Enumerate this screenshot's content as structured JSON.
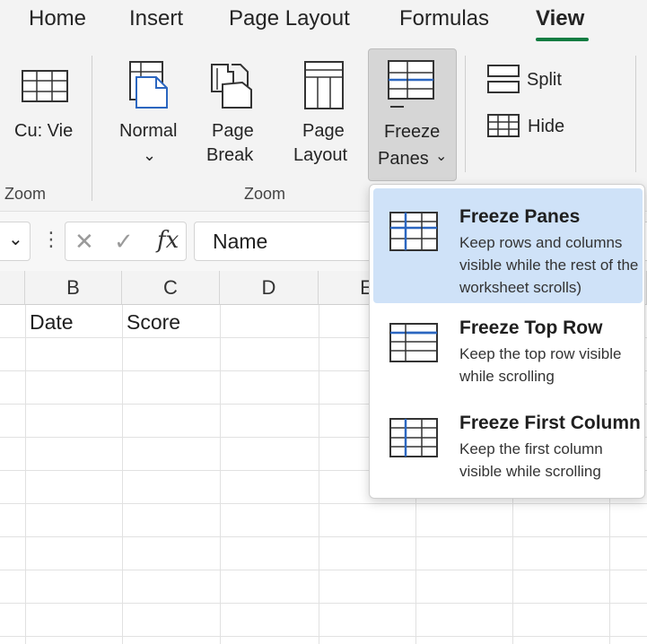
{
  "tabs": {
    "home": "Home",
    "insert": "Insert",
    "page_layout": "Page Layout",
    "formulas": "Formulas",
    "view": "View"
  },
  "ribbon": {
    "custom_views_label": "Cu: Vie",
    "normal_label": "Normal",
    "page_break_label_1": "Page",
    "page_break_label_2": "Break",
    "page_layout_label_1": "Page",
    "page_layout_label_2": "Layout",
    "freeze_label_1": "Freeze",
    "freeze_label_2": "Panes",
    "split_label": "Split",
    "hide_label": "Hide",
    "group_left": "Zoom",
    "group_middle": "Zoom",
    "dropdown_chevron": "⌄"
  },
  "formula_bar": {
    "name_box_chevron": "⌄",
    "more_dots": "⋮",
    "cancel_glyph": "✕",
    "enter_glyph": "✓",
    "fx_label": "fx",
    "formula_value": "Name"
  },
  "grid": {
    "columns": [
      "B",
      "C",
      "D",
      "E"
    ],
    "row1": [
      "Date",
      "Score"
    ]
  },
  "menu": {
    "items": [
      {
        "title": "Freeze Panes",
        "desc": "Keep rows and columns visible while the rest of the worksheet scrolls)"
      },
      {
        "title": "Freeze Top Row",
        "desc": "Keep the top row visible while scrolling"
      },
      {
        "title": "Freeze First Column",
        "desc": "Keep the first column visible while scrolling"
      }
    ]
  },
  "colors": {
    "accent_green": "#107c41",
    "selected_bg": "#cfe2f8",
    "icon_blue": "#2b66c0"
  }
}
